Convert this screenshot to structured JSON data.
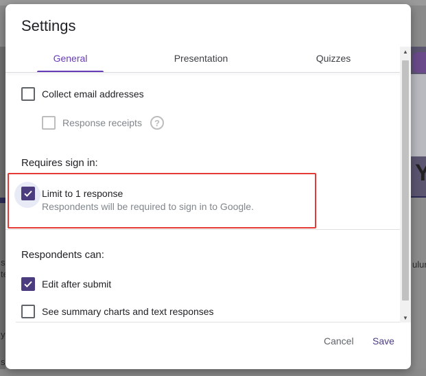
{
  "dialog": {
    "title": "Settings",
    "tabs": [
      {
        "label": "General",
        "active": true
      },
      {
        "label": "Presentation",
        "active": false
      },
      {
        "label": "Quizzes",
        "active": false
      }
    ],
    "settings": {
      "collect_email": {
        "label": "Collect email addresses",
        "checked": false
      },
      "response_receipts": {
        "label": "Response receipts",
        "checked": false,
        "disabled": true,
        "help_icon": "?"
      },
      "requires_sign_in": {
        "heading": "Requires sign in:",
        "limit_one": {
          "label": "Limit to 1 response",
          "description": "Respondents will be required to sign in to Google.",
          "checked": true
        }
      },
      "respondents_can": {
        "heading": "Respondents can:",
        "edit_after_submit": {
          "label": "Edit after submit",
          "checked": true
        },
        "see_summary": {
          "label": "See summary charts and text responses",
          "checked": false
        }
      }
    },
    "footer": {
      "cancel_label": "Cancel",
      "save_label": "Save"
    }
  },
  "colors": {
    "accent": "#673ab7",
    "checkbox_checked": "#4a3c7e",
    "highlight": "#e53935"
  },
  "background": {
    "left_texts": [
      "s",
      "te",
      "y",
      "su"
    ],
    "right_text": "ulun",
    "right_letter": "Y"
  }
}
